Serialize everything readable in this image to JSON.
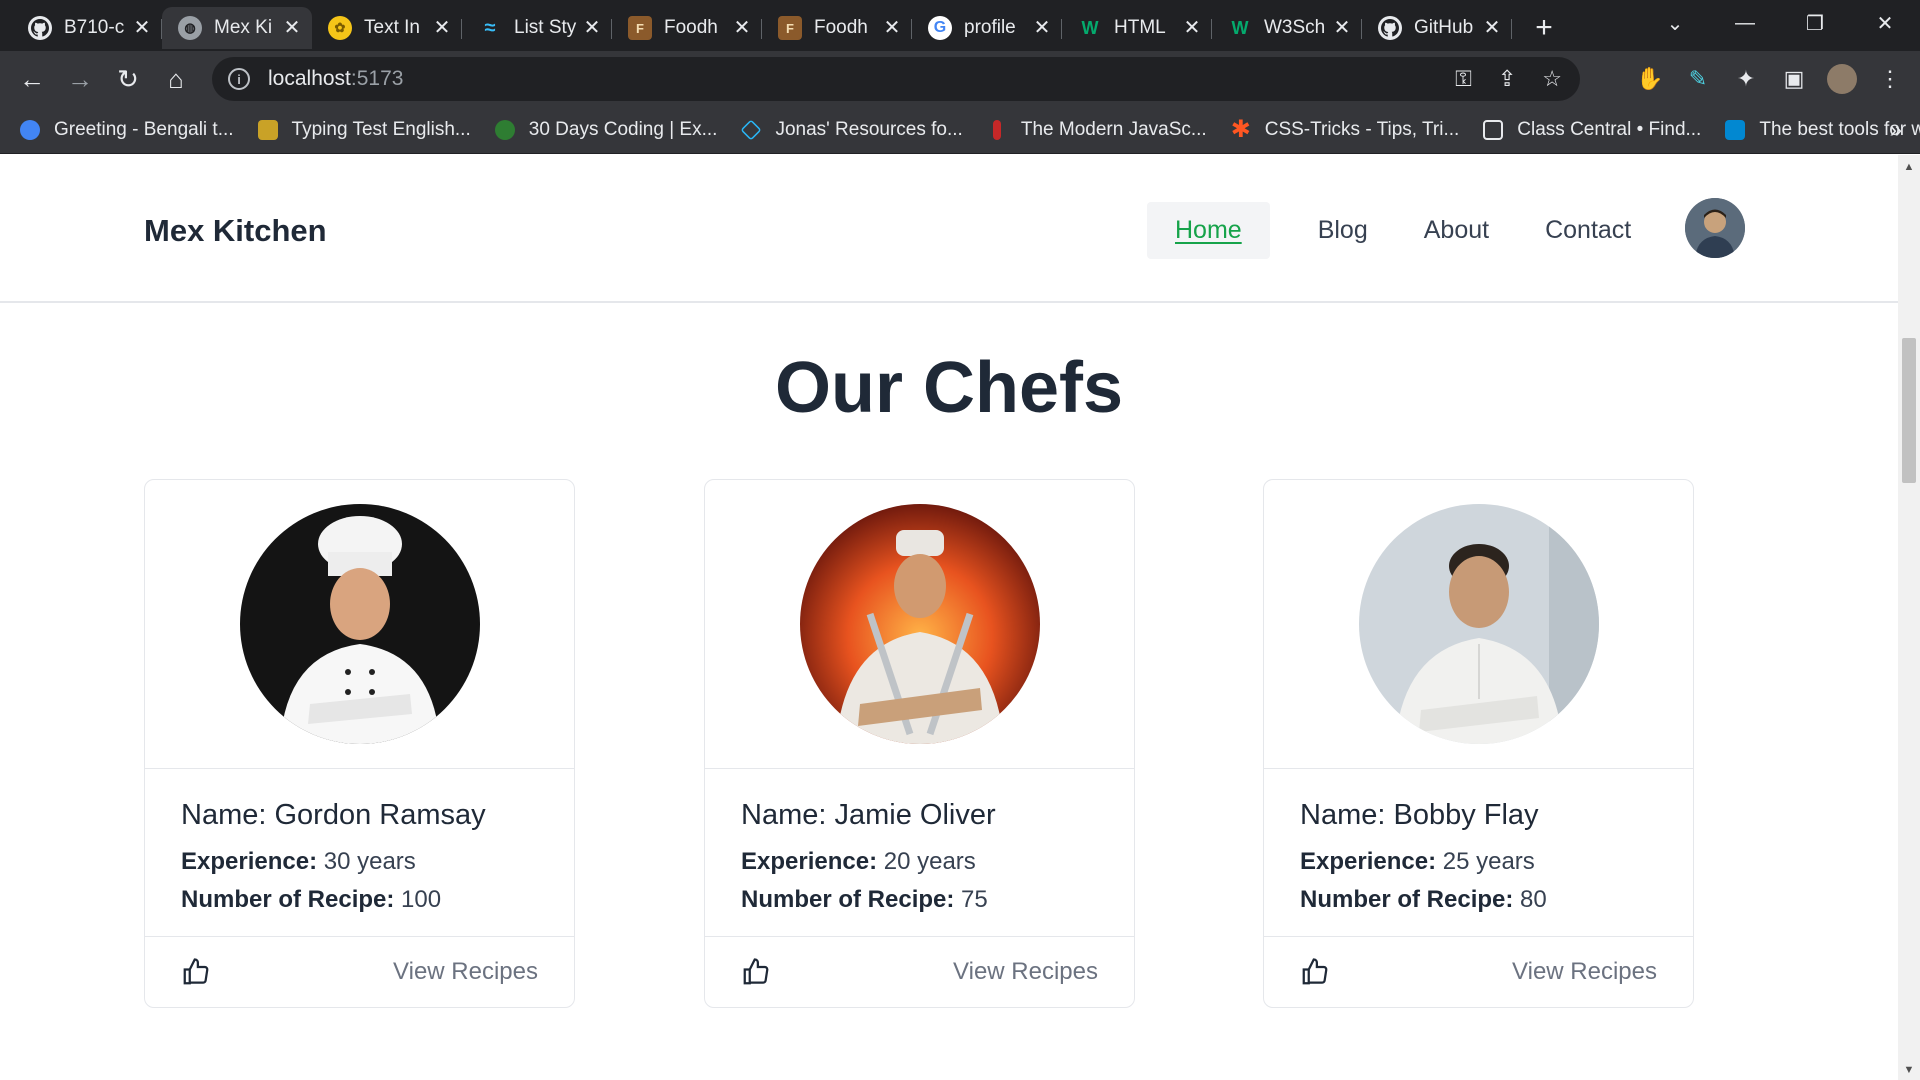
{
  "browser": {
    "tabs": [
      {
        "title": "B710-c",
        "icon": "github-icon",
        "active": false
      },
      {
        "title": "Mex Ki",
        "icon": "globe-icon",
        "active": true
      },
      {
        "title": "Text In",
        "icon": "flower-icon",
        "active": false
      },
      {
        "title": "List Sty",
        "icon": "tailwind-icon",
        "active": false
      },
      {
        "title": "Foodh",
        "icon": "foodhub-icon",
        "active": false
      },
      {
        "title": "Foodh",
        "icon": "foodhub-icon",
        "active": false
      },
      {
        "title": "profile",
        "icon": "google-icon",
        "active": false
      },
      {
        "title": "HTML",
        "icon": "w3schools-icon",
        "active": false
      },
      {
        "title": "W3Sch",
        "icon": "w3schools-icon",
        "active": false
      },
      {
        "title": "GitHub",
        "icon": "github-icon",
        "active": false
      }
    ],
    "url_host": "localhost",
    "url_port": ":5173",
    "bookmarks": [
      {
        "label": "Greeting - Bengali t...",
        "color": "#4285f4"
      },
      {
        "label": "Typing Test English...",
        "color": "#c9a227"
      },
      {
        "label": "30 Days Coding | Ex...",
        "color": "#2e7d32"
      },
      {
        "label": "Jonas' Resources fo...",
        "color": "#29b6f6"
      },
      {
        "label": "The Modern JavaSc...",
        "color": "#c62828"
      },
      {
        "label": "CSS-Tricks - Tips, Tri...",
        "color": "#ff5722"
      },
      {
        "label": "Class Central • Find...",
        "color": "#1565c0"
      },
      {
        "label": "The best tools for w...",
        "color": "#0288d1"
      }
    ]
  },
  "site": {
    "brand": "Mex Kitchen",
    "nav": {
      "home": "Home",
      "blog": "Blog",
      "about": "About",
      "contact": "Contact"
    },
    "accent_color": "#16a34a"
  },
  "section": {
    "title": "Our Chefs"
  },
  "chefs": [
    {
      "name": "Name: Gordon Ramsay",
      "exp_label": "Experience:",
      "exp_value": " 30 years",
      "recipe_label": "Number of Recipe:",
      "recipe_value": " 100",
      "action": "View Recipes"
    },
    {
      "name": "Name: Jamie Oliver",
      "exp_label": "Experience:",
      "exp_value": " 20 years",
      "recipe_label": "Number of Recipe:",
      "recipe_value": " 75",
      "action": "View Recipes"
    },
    {
      "name": "Name: Bobby Flay",
      "exp_label": "Experience:",
      "exp_value": " 25 years",
      "recipe_label": "Number of Recipe:",
      "recipe_value": " 80",
      "action": "View Recipes"
    }
  ]
}
